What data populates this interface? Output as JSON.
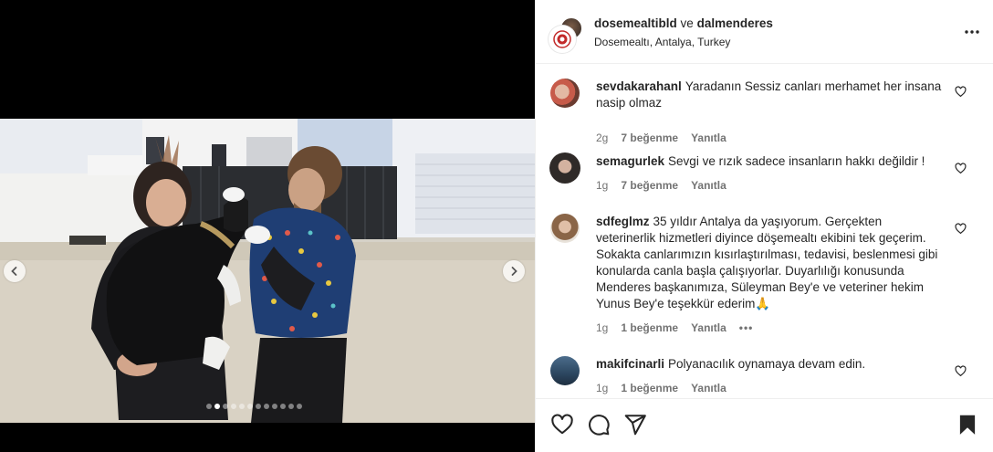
{
  "post": {
    "author": "dosemealtibld",
    "conjunction": "ve",
    "coauthor": "dalmenderes",
    "location": "Dosemealtı, Antalya, Turkey",
    "carousel": {
      "total_slides": 12,
      "active_slide": 2
    }
  },
  "comments": [
    {
      "user": "sevdakarahanl",
      "text": "Yaradanın Sessiz canları merhamet her insana nasip olmaz",
      "time": "2g",
      "likes": "7 beğenme",
      "reply": "Yanıtla"
    },
    {
      "user": "semagurlek",
      "text": "Sevgi ve rızık sadece insanların hakkı değildir !",
      "time": "1g",
      "likes": "7 beğenme",
      "reply": "Yanıtla"
    },
    {
      "user": "sdfeglmz",
      "text": "35 yıldır Antalya da yaşıyorum. Gerçekten veterinerlik hizmetleri diyince döşemealtı ekibini tek geçerim. Sokakta canlarımızın kısırlaştırılması, tedavisi, beslenmesi gibi konularda canla başla çalışıyorlar. Duyarlılığı konusunda Menderes başkanımıza, Süleyman Bey'e ve veteriner hekim Yunus Bey'e teşekkür ederim🙏",
      "time": "1g",
      "likes": "1 beğenme",
      "reply": "Yanıtla",
      "more": "•••"
    },
    {
      "user": "makifcinarli",
      "text": "Polyanacılık oynamaya devam edin.",
      "time": "1g",
      "likes": "1 beğenme",
      "reply": "Yanıtla"
    }
  ],
  "icons": {
    "more": "more-horizontal-icon",
    "like": "heart-icon",
    "comment": "comment-icon",
    "share": "share-icon",
    "save": "bookmark-icon"
  }
}
